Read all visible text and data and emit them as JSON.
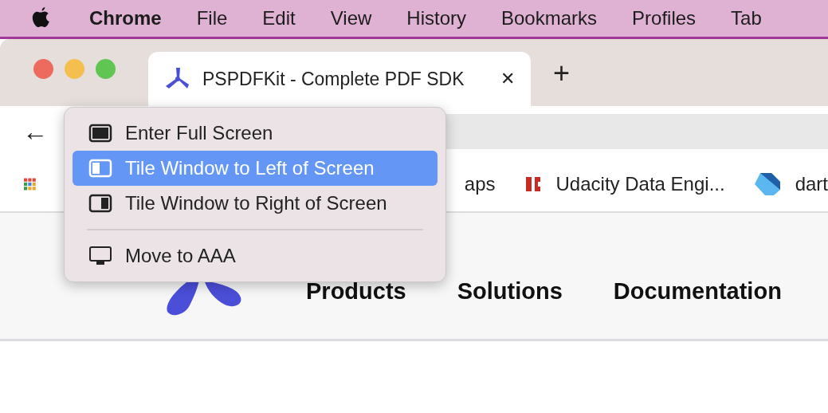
{
  "menu_bar": {
    "app": "Chrome",
    "items": [
      "File",
      "Edit",
      "View",
      "History",
      "Bookmarks",
      "Profiles",
      "Tab"
    ]
  },
  "tab": {
    "title": "PSPDFKit - Complete PDF SDK",
    "close": "✕",
    "selected": true
  },
  "new_tab": "+",
  "back": "←",
  "bookmarks": [
    {
      "kind": "apps"
    },
    {
      "kind": "plain",
      "label": "aps"
    },
    {
      "kind": "udacity",
      "label": "Udacity Data Engi..."
    },
    {
      "kind": "dart",
      "label": "dart"
    }
  ],
  "site_nav": [
    "Products",
    "Solutions",
    "Documentation"
  ],
  "window_menu": {
    "items": [
      {
        "kind": "full",
        "label": "Enter Full Screen",
        "selected": false
      },
      {
        "kind": "left",
        "label": "Tile Window to Left of Screen",
        "selected": true
      },
      {
        "kind": "right",
        "label": "Tile Window to Right of Screen",
        "selected": false
      },
      {
        "kind": "separator"
      },
      {
        "kind": "display",
        "label": "Move to AAA",
        "selected": false
      }
    ]
  }
}
